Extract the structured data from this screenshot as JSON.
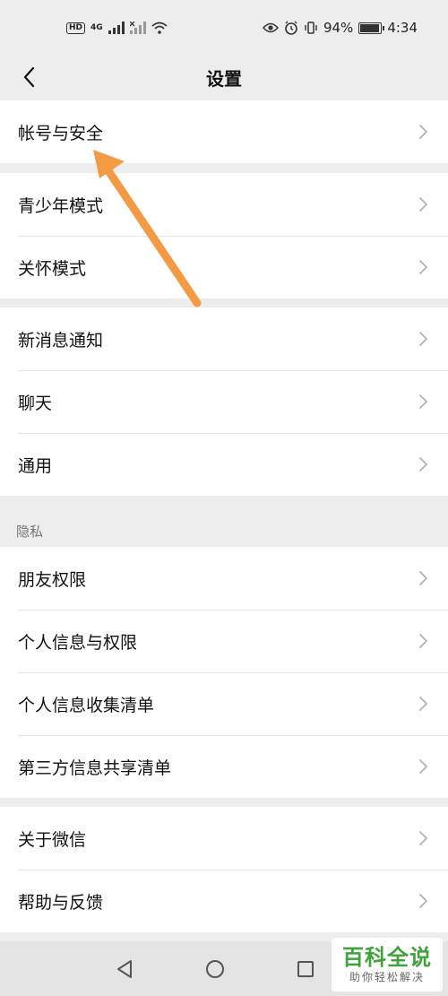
{
  "status_bar": {
    "hd": "HD",
    "network": "4G",
    "battery": "94%",
    "battery_level": 0.94,
    "time": "4:34"
  },
  "nav": {
    "title": "设置"
  },
  "groups": [
    {
      "items": [
        "帐号与安全"
      ]
    },
    {
      "items": [
        "青少年模式",
        "关怀模式"
      ]
    },
    {
      "items": [
        "新消息通知",
        "聊天",
        "通用"
      ]
    },
    {
      "section_label": "隐私",
      "items": [
        "朋友权限",
        "个人信息与权限",
        "个人信息收集清单",
        "第三方信息共享清单"
      ]
    },
    {
      "items": [
        "关于微信",
        "帮助与反馈"
      ]
    }
  ],
  "colors": {
    "arrow": "#f39a45",
    "background": "#ededed",
    "watermark_green": "#3fa23a"
  },
  "icons": {
    "back": "chevron-left-icon",
    "row": "chevron-right-icon"
  },
  "watermark": {
    "title": "百科全说",
    "subtitle": "助你轻松解决"
  }
}
